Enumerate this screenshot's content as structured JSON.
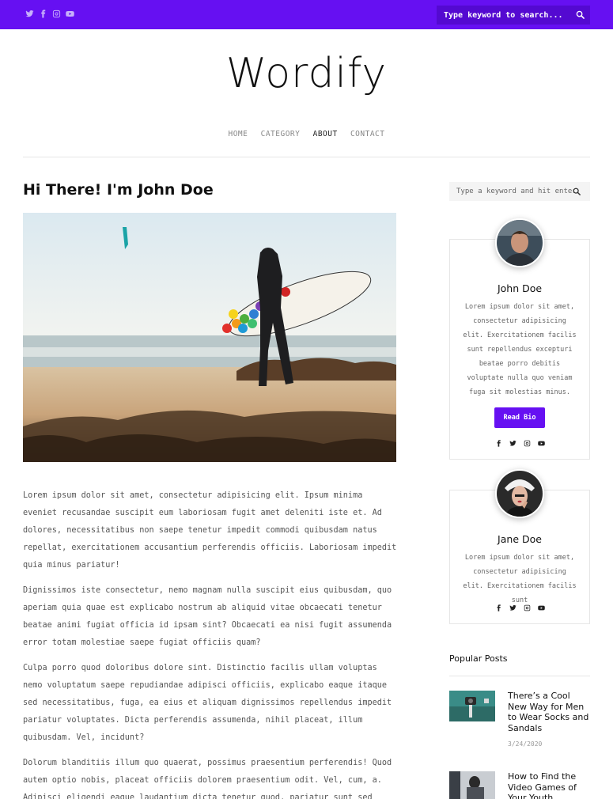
{
  "topbar": {
    "social_icons": [
      "twitter-icon",
      "facebook-icon",
      "instagram-icon",
      "youtube-icon"
    ],
    "search_placeholder": "Type keyword to search...",
    "accent_color": "#6610f2"
  },
  "header": {
    "logo": "Wordify",
    "nav": [
      {
        "label": "HOME",
        "active": false
      },
      {
        "label": "CATEGORY",
        "active": false
      },
      {
        "label": "ABOUT",
        "active": true
      },
      {
        "label": "CONTACT",
        "active": false
      }
    ]
  },
  "main": {
    "title": "Hi There! I'm John Doe",
    "paragraphs": [
      "Lorem ipsum dolor sit amet, consectetur adipisicing elit. Ipsum minima eveniet recusandae suscipit eum laboriosam fugit amet deleniti iste et. Ad dolores, necessitatibus non saepe tenetur impedit commodi quibusdam natus repellat, exercitationem accusantium perferendis officiis. Laboriosam impedit quia minus pariatur!",
      "Dignissimos iste consectetur, nemo magnam nulla suscipit eius quibusdam, quo aperiam quia quae est explicabo nostrum ab aliquid vitae obcaecati tenetur beatae animi fugiat officia id ipsam sint? Obcaecati ea nisi fugit assumenda error totam molestiae saepe fugiat officiis quam?",
      "Culpa porro quod doloribus dolore sint. Distinctio facilis ullam voluptas nemo voluptatum saepe repudiandae adipisci officiis, explicabo eaque itaque sed necessitatibus, fuga, ea eius et aliquam dignissimos repellendus impedit pariatur voluptates. Dicta perferendis assumenda, nihil placeat, illum quibusdam. Vel, incidunt?",
      "Dolorum blanditiis illum quo quaerat, possimus praesentium perferendis! Quod autem optio nobis, placeat officiis dolorem praesentium odit. Vel, cum, a. Adipisci eligendi eaque laudantium dicta tenetur quod, pariatur sunt sed natus officia fugiat."
    ]
  },
  "sidebar": {
    "search_placeholder": "Type a keyword and hit enter",
    "bios": [
      {
        "name": "John Doe",
        "text": "Lorem ipsum dolor sit amet, consectetur adipisicing elit. Exercitationem facilis sunt repellendus excepturi beatae porro debitis voluptate nulla quo veniam fuga sit molestias minus.",
        "button": "Read Bio",
        "social_icons": [
          "facebook-icon",
          "twitter-icon",
          "instagram-icon",
          "youtube-icon"
        ]
      },
      {
        "name": "Jane Doe",
        "text": "Lorem ipsum dolor sit amet, consectetur adipisicing elit. Exercitationem facilis sunt",
        "social_icons": [
          "facebook-icon",
          "twitter-icon",
          "instagram-icon",
          "youtube-icon"
        ]
      }
    ],
    "popular": {
      "heading": "Popular Posts",
      "posts": [
        {
          "title": "There’s a Cool New Way for Men to Wear Socks and Sandals",
          "date": "3/24/2020"
        },
        {
          "title": "How to Find the Video Games of Your Youth",
          "date": ""
        }
      ]
    }
  }
}
